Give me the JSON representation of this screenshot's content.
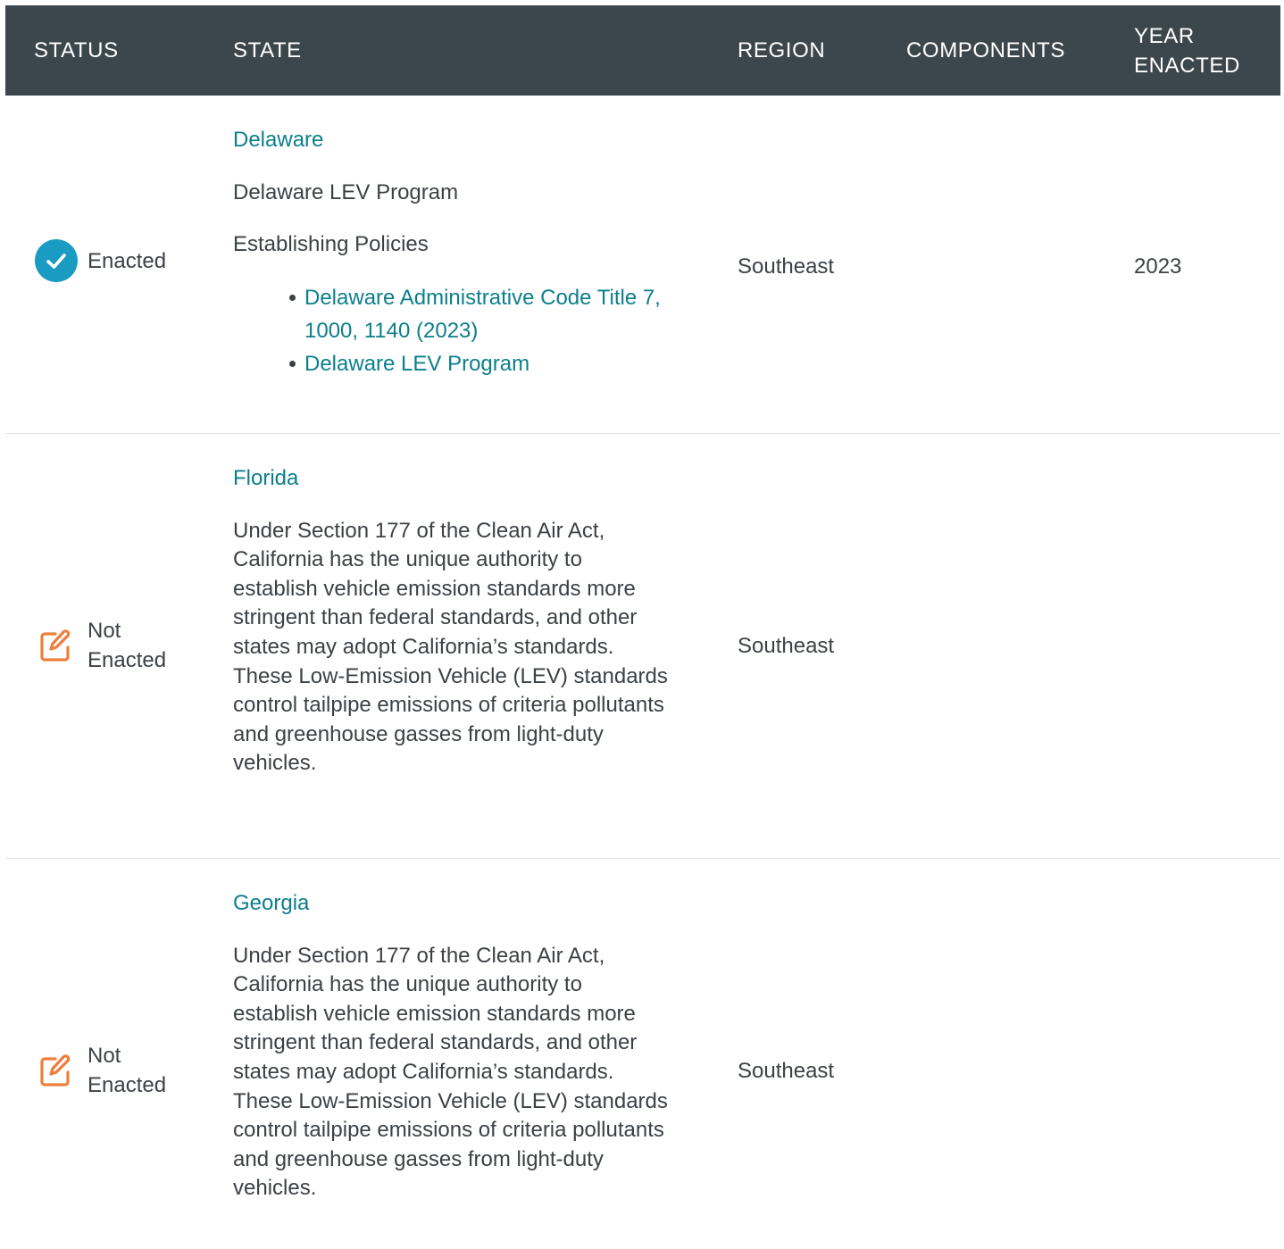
{
  "columns": {
    "status": "STATUS",
    "state": "STATE",
    "region": "REGION",
    "components": "COMPONENTS",
    "year": "YEAR ENACTED"
  },
  "colors": {
    "header_bg": "#3c474d",
    "link": "#0c7f8c",
    "enacted_icon": "#1a9bc2",
    "not_enacted_icon": "#ef7d3c"
  },
  "rows": [
    {
      "status": "Enacted",
      "status_icon": "check-circle-icon",
      "state": "Delaware",
      "policy_name": "Delaware LEV Program",
      "section_label": "Establishing Policies",
      "links": [
        "Delaware Administrative Code Title 7, 1000, 1140 (2023)",
        "Delaware LEV Program"
      ],
      "region": "Southeast",
      "components": "",
      "year": "2023"
    },
    {
      "status": "Not Enacted",
      "status_icon": "edit-icon",
      "state": "Florida",
      "description": "Under Section 177 of the Clean Air Act, California has the unique authority to establish vehicle emission standards more stringent than federal standards, and other states may adopt California’s standards. These Low-Emission Vehicle (LEV) standards control tailpipe emissions of criteria pollutants and greenhouse gasses from light-duty vehicles.",
      "region": "Southeast",
      "components": "",
      "year": ""
    },
    {
      "status": "Not Enacted",
      "status_icon": "edit-icon",
      "state": "Georgia",
      "description": "Under Section 177 of the Clean Air Act, California has the unique authority to establish vehicle emission standards more stringent than federal standards, and other states may adopt California’s standards. These Low-Emission Vehicle (LEV) standards control tailpipe emissions of criteria pollutants and greenhouse gasses from light-duty vehicles.",
      "region": "Southeast",
      "components": "",
      "year": ""
    }
  ]
}
